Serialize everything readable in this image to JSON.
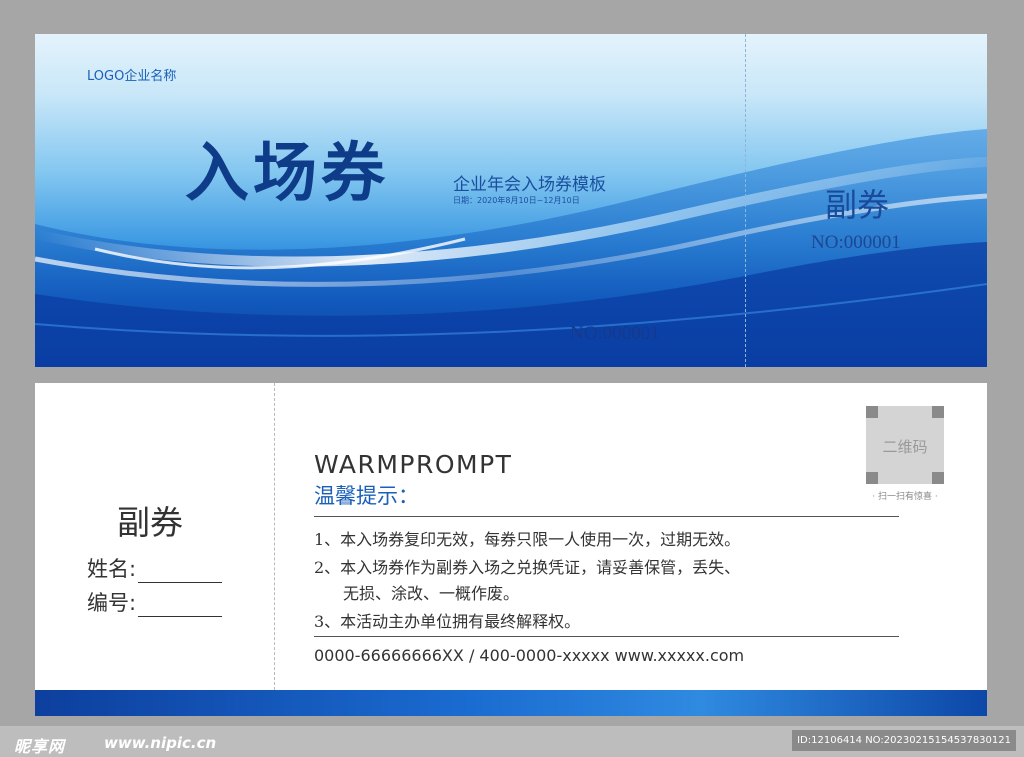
{
  "front": {
    "logo": "LOGO企业名称",
    "title": "入场券",
    "subtitle": "企业年会入场券模板",
    "date": "日期：2020年8月10日~12月10日",
    "number": "NO:000001",
    "stub_title": "副券",
    "stub_number": "NO:000001"
  },
  "back": {
    "stub_title": "副券",
    "name_label": "姓名:",
    "id_label": "编号:",
    "warm_en": "WARMPROMPT",
    "warm_cn": "温馨提示：",
    "notes": [
      "1、本入场券复印无效，每券只限一人使用一次，过期无效。",
      "2、本入场券作为副券入场之兑换凭证，请妥善保管，丢失、",
      "无损、涂改、一概作废。",
      "3、本活动主办单位拥有最终解释权。"
    ],
    "contact": "0000-66666666XX / 400-0000-xxxxx  www.xxxxx.com",
    "qr_text": "二维码",
    "qr_caption": "· 扫一扫有惊喜 ·"
  },
  "footer": {
    "brand": "昵享网",
    "url": "www.nipic.cn",
    "id": "ID:12106414 NO:20230215154537830121"
  },
  "colors": {
    "accent": "#1a5fb8",
    "deep_blue": "#0a40a8",
    "background": "#a6a6a6"
  }
}
